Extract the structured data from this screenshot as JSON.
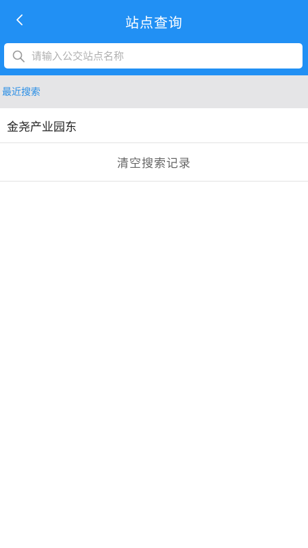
{
  "header": {
    "title": "站点查询",
    "back_icon": "chevron-left-icon",
    "background_color": "#2190f4"
  },
  "search": {
    "icon": "search-icon",
    "value": "",
    "placeholder": "请输入公交站点名称"
  },
  "recent": {
    "label": "最近搜索",
    "label_color": "#2b8fe6",
    "items": [
      {
        "label": "金尧产业园东"
      }
    ],
    "clear_label": "清空搜索记录"
  }
}
